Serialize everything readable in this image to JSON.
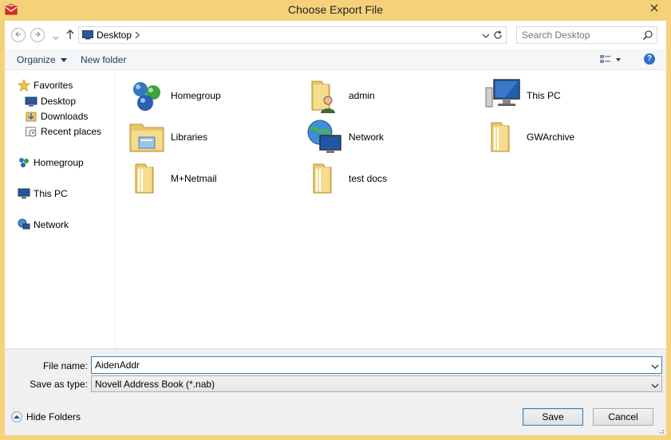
{
  "window": {
    "title": "Choose Export File"
  },
  "nav": {
    "location": "Desktop",
    "search_placeholder": "Search Desktop"
  },
  "toolbar": {
    "organize_label": "Organize",
    "new_folder_label": "New folder"
  },
  "sidebar": {
    "favorites_label": "Favorites",
    "favorites": [
      {
        "label": "Desktop",
        "icon": "desktop-icon"
      },
      {
        "label": "Downloads",
        "icon": "downloads-icon"
      },
      {
        "label": "Recent places",
        "icon": "recent-places-icon"
      }
    ],
    "homegroup_label": "Homegroup",
    "thispc_label": "This PC",
    "network_label": "Network"
  },
  "items": [
    {
      "label": "Homegroup",
      "icon": "homegroup-icon"
    },
    {
      "label": "admin",
      "icon": "user-folder-icon"
    },
    {
      "label": "This PC",
      "icon": "computer-icon"
    },
    {
      "label": "Libraries",
      "icon": "libraries-icon"
    },
    {
      "label": "Network",
      "icon": "network-icon"
    },
    {
      "label": "GWArchive",
      "icon": "folder-icon"
    },
    {
      "label": "M+Netmail",
      "icon": "folder-icon"
    },
    {
      "label": "test docs",
      "icon": "folder-icon"
    }
  ],
  "form": {
    "file_name_label": "File name:",
    "file_name_value": "AidenAddr",
    "save_type_label": "Save as type:",
    "save_type_value": "Novell Address Book (*.nab)"
  },
  "buttons": {
    "hide_folders_label": "Hide Folders",
    "save_label": "Save",
    "cancel_label": "Cancel"
  },
  "colors": {
    "frame": "#f5d27a",
    "accent": "#3c7fb1",
    "link": "#1e395b"
  }
}
